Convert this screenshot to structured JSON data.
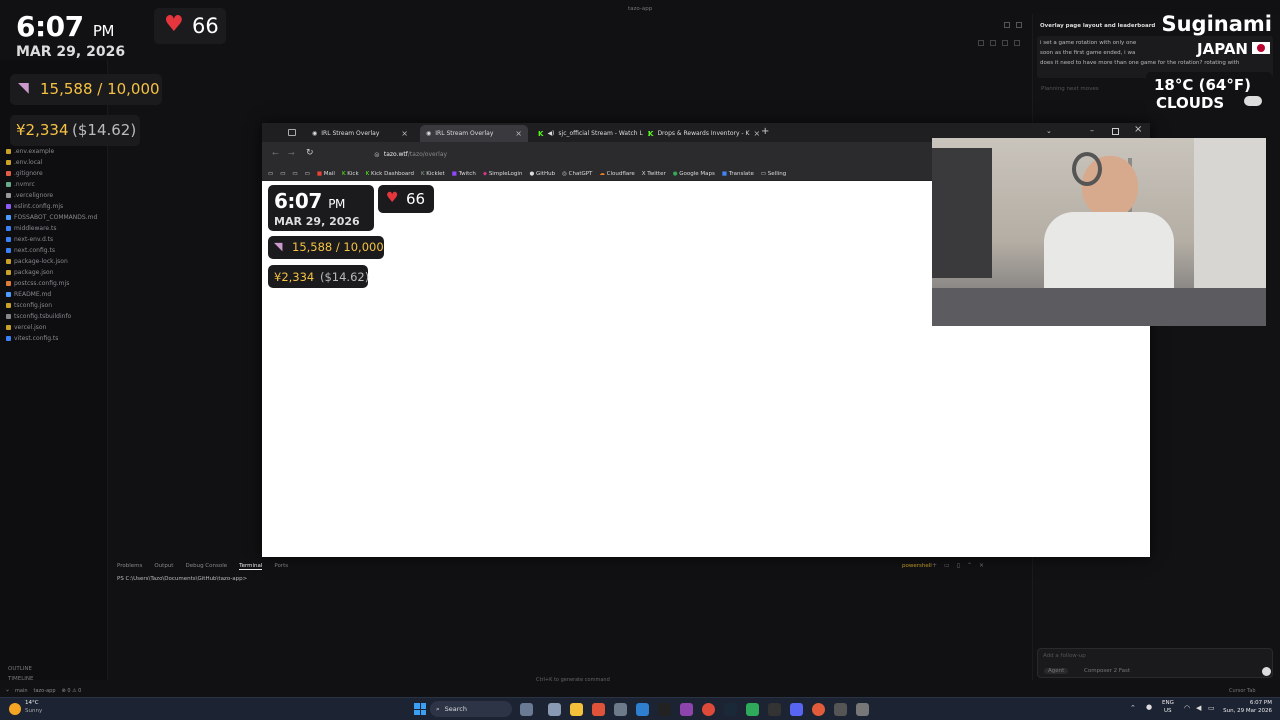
{
  "window": {
    "title": "tazo-app"
  },
  "stream_overlay": {
    "time": "6:07",
    "ampm": "PM",
    "date": "MAR 29, 2026",
    "viewers": "66",
    "steps": "15,588 / 10,000",
    "yen": "¥2,334",
    "usd": "($14.62)",
    "location_city": "Suginami",
    "location_country": "JAPAN",
    "weather_temp": "18°C (64°F)",
    "weather_cond": "CLOUDS"
  },
  "sidebar": {
    "files": [
      {
        "name": ".env.example",
        "color": "#c9a227"
      },
      {
        "name": ".env.local",
        "color": "#c9a227"
      },
      {
        "name": ".gitignore",
        "color": "#e05d44"
      },
      {
        "name": ".nvmrc",
        "color": "#6a8"
      },
      {
        "name": ".vercelignore",
        "color": "#999"
      },
      {
        "name": "eslint.config.mjs",
        "color": "#8b5cf6"
      },
      {
        "name": "FOSSABOT_COMMANDS.md",
        "color": "#4a9eff"
      },
      {
        "name": "middleware.ts",
        "color": "#3b82f6"
      },
      {
        "name": "next-env.d.ts",
        "color": "#3b82f6"
      },
      {
        "name": "next.config.ts",
        "color": "#3b82f6"
      },
      {
        "name": "package-lock.json",
        "color": "#c9a227"
      },
      {
        "name": "package.json",
        "color": "#c9a227"
      },
      {
        "name": "postcss.config.mjs",
        "color": "#e07b39"
      },
      {
        "name": "README.md",
        "color": "#4a9eff"
      },
      {
        "name": "tsconfig.json",
        "color": "#c9a227"
      },
      {
        "name": "tsconfig.tsbuildinfo",
        "color": "#888"
      },
      {
        "name": "vercel.json",
        "color": "#c9a227"
      },
      {
        "name": "vitest.config.ts",
        "color": "#3b82f6"
      }
    ],
    "outline": "OUTLINE",
    "timeline": "TIMELINE",
    "status": "main",
    "status_repo": "tazo-app"
  },
  "ai_panel": {
    "title": "Overlay page layout and leaderboard",
    "msg1": "i set a game rotation with only one",
    "msg2": "soon as the first game ended, i wa",
    "msg3": "does it need to have more than one game for the rotation? rotating with",
    "planning": "Planning next moves",
    "input_placeholder": "Add a follow-up",
    "agent": "Agent",
    "model": "Composer 2 Fast",
    "cursor_tab": "Cursor Tab"
  },
  "browser": {
    "tabs": [
      {
        "label": "IRL Stream Overlay"
      },
      {
        "label": "IRL Stream Overlay"
      },
      {
        "label": "sjc_official Stream - Watch L"
      },
      {
        "label": "Drops & Rewards Inventory - K"
      }
    ],
    "url_host": "tazo.wtf",
    "url_path": "/tazo/overlay",
    "bookmarks": [
      "Mail",
      "Kick",
      "Kick Dashboard",
      "Kicklet",
      "Twitch",
      "SimpleLogin",
      "GitHub",
      "ChatGPT",
      "Cloudflare",
      "Twitter",
      "Google Maps",
      "Translate",
      "Selling"
    ]
  },
  "terminal": {
    "tabs": [
      "Problems",
      "Output",
      "Debug Console",
      "Terminal",
      "Ports"
    ],
    "shell": "powershell",
    "prompt": "PS C:\\Users\\Tazo\\Documents\\GitHub\\tazo-app>",
    "hint": "Ctrl+K to generate command"
  },
  "taskbar": {
    "weather_temp": "14°C",
    "weather_desc": "Sunny",
    "search": "Search",
    "lang": "ENG",
    "region": "US",
    "clock": "6:07 PM",
    "date": "Sun, 29 Mar 2026"
  }
}
